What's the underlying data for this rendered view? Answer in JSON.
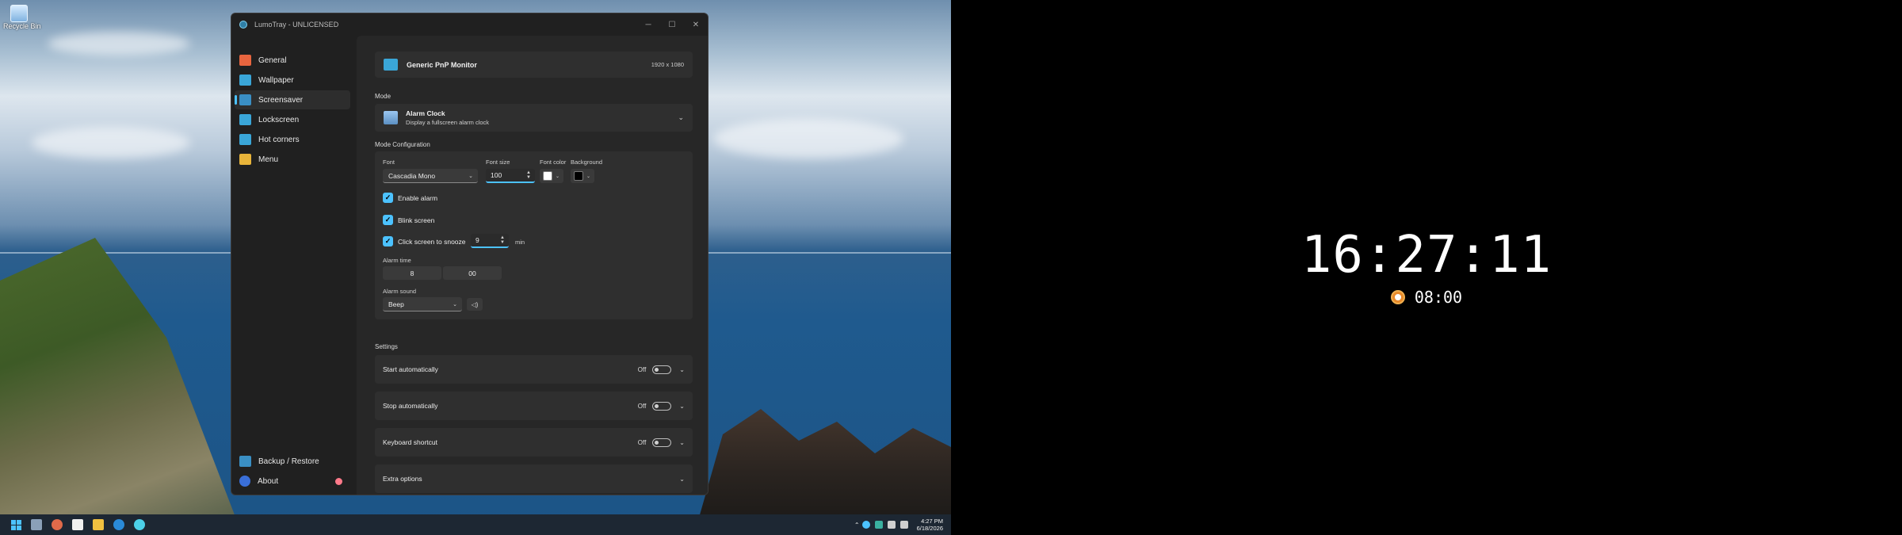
{
  "desktop": {
    "recycle_bin_label": "Recycle Bin"
  },
  "window": {
    "title": "LumoTray - UNLICENSED"
  },
  "sidebar": {
    "items": [
      {
        "label": "General",
        "icon": "home-icon",
        "color": "#e85a3a"
      },
      {
        "label": "Wallpaper",
        "icon": "wallpaper-icon",
        "color": "#3aa6d8"
      },
      {
        "label": "Screensaver",
        "icon": "screensaver-icon",
        "color": "#3aa6d8"
      },
      {
        "label": "Lockscreen",
        "icon": "lockscreen-icon",
        "color": "#3aa6d8"
      },
      {
        "label": "Hot corners",
        "icon": "hot-corners-icon",
        "color": "#3aa6d8"
      },
      {
        "label": "Menu",
        "icon": "menu-tree-icon",
        "color": "#e8b43a"
      }
    ],
    "selected": "Screensaver",
    "bottom_items": [
      {
        "label": "Backup / Restore",
        "icon": "backup-icon"
      },
      {
        "label": "About",
        "icon": "info-icon"
      }
    ]
  },
  "monitor": {
    "name": "Generic PnP Monitor",
    "resolution": "1920 x 1080"
  },
  "mode": {
    "section_label": "Mode",
    "title": "Alarm Clock",
    "description": "Display a fullscreen alarm clock"
  },
  "config": {
    "section_label": "Mode Configuration",
    "font_label": "Font",
    "font_value": "Cascadia Mono",
    "font_size_label": "Font size",
    "font_size_value": "100",
    "font_color_label": "Font color",
    "font_color": "#ffffff",
    "background_label": "Background",
    "background_color": "#000000",
    "enable_alarm_label": "Enable alarm",
    "blink_screen_label": "Blink screen",
    "snooze_label": "Click screen to snooze",
    "snooze_value": "9",
    "snooze_unit": "min",
    "alarm_time_label": "Alarm time",
    "alarm_hour": "8",
    "alarm_minute": "00",
    "alarm_sound_label": "Alarm sound",
    "alarm_sound_value": "Beep"
  },
  "settings": {
    "section_label": "Settings",
    "rows": [
      {
        "label": "Start automatically",
        "state": "Off"
      },
      {
        "label": "Stop automatically",
        "state": "Off"
      },
      {
        "label": "Keyboard shortcut",
        "state": "Off"
      }
    ],
    "extra_label": "Extra options"
  },
  "taskbar": {
    "time": "4:27 PM",
    "date": "6/18/2026"
  },
  "screensaver": {
    "clock_time": "16:27:11",
    "alarm_time": "08:00"
  },
  "colors": {
    "accent": "#4cc2ff",
    "window_bg": "#202020",
    "card_bg": "#2f2f2f"
  }
}
